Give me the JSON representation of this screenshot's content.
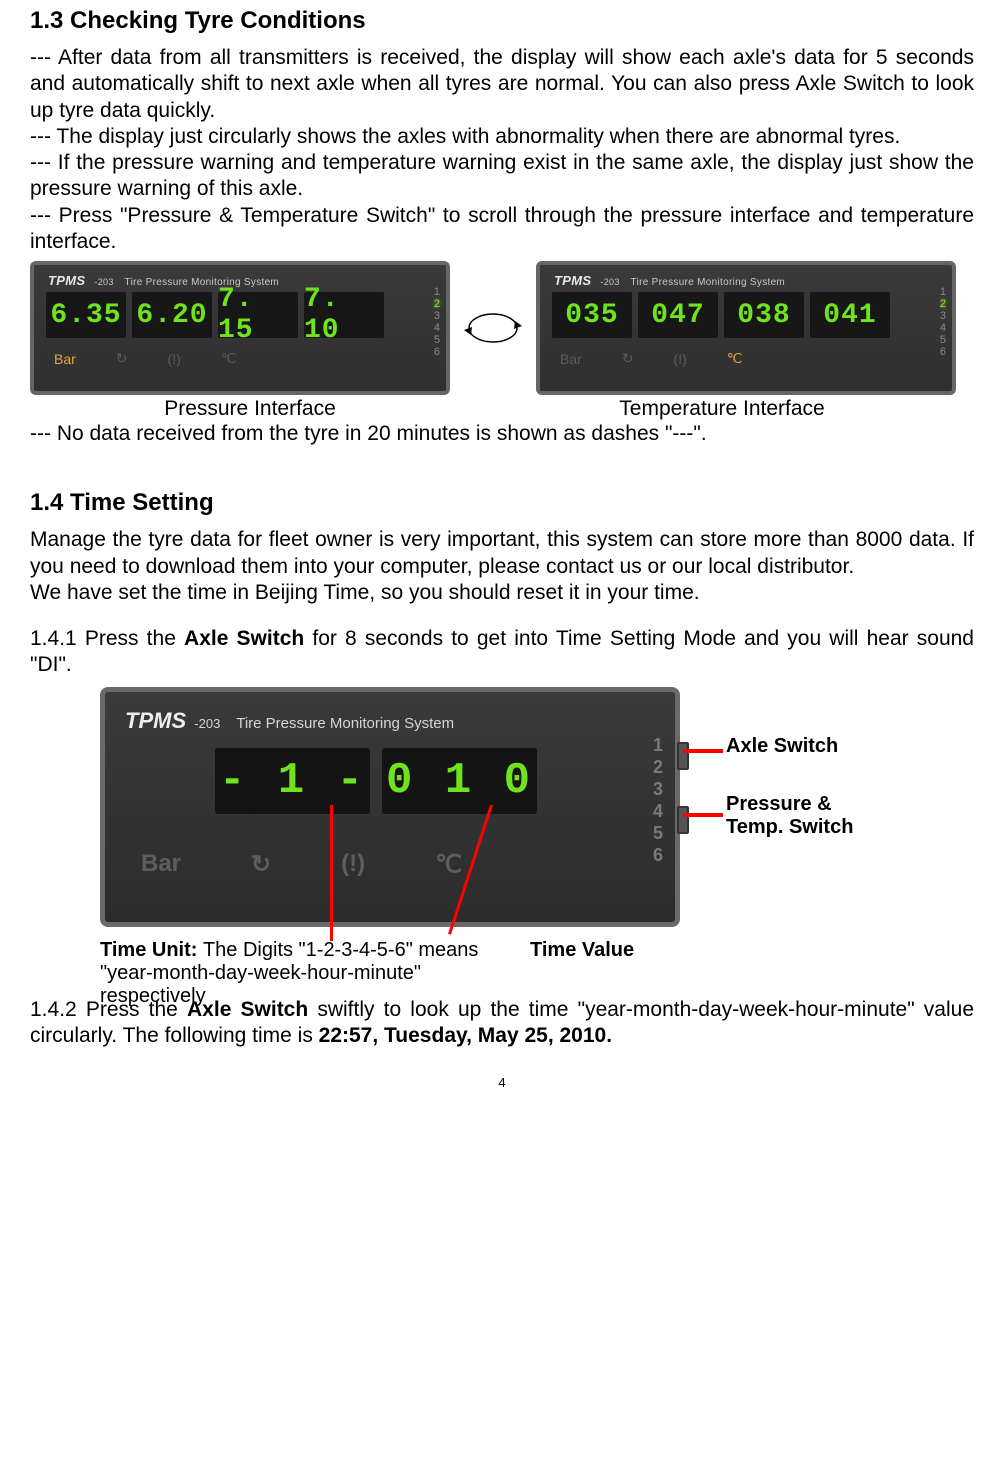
{
  "sections": {
    "s13": {
      "heading": "1.3 Checking Tyre Conditions",
      "p1": "--- After data from all transmitters is received, the display will show each axle's data for 5 seconds and automatically shift to next axle when all tyres are normal. You can also press Axle Switch to look up tyre data quickly.",
      "p2": "--- The display just circularly shows the axles with abnormality when there are abnormal tyres.",
      "p3": "--- If the pressure warning and temperature warning exist in the same axle, the display just show the pressure warning of this axle.",
      "p4": "--- Press \"Pressure & Temperature Switch\" to scroll through the pressure interface and temperature interface.",
      "caption_left": "Pressure Interface",
      "caption_right": "Temperature Interface",
      "p5": "--- No data received from the tyre in 20 minutes is shown as dashes \"---\"."
    },
    "s14": {
      "heading": "1.4 Time Setting",
      "p1": "Manage the tyre data for fleet owner is very important, this system can store more than 8000 data. If you need to download them into your computer, please contact us or our local distributor.",
      "p2": "We have set the time in Beijing Time, so you should reset it in your time.",
      "p3_prefix": "1.4.1 Press the ",
      "p3_bold": "Axle Switch",
      "p3_mid": " for 8 seconds to get into Time Setting Mode and you will hear sound \"DI\".",
      "anno_axle": "Axle Switch",
      "anno_pt1": "Pressure &",
      "anno_pt2": "Temp. Switch",
      "anno_timeunit_b": "Time Unit: ",
      "anno_timeunit_rest": "The Digits \"1-2-3-4-5-6\" means",
      "anno_timeunit_line2": "\"year-month-day-week-hour-minute\" respectively",
      "anno_timevalue": "Time Value",
      "p4_prefix": "1.4.2 Press the ",
      "p4_bold1": "Axle Switch",
      "p4_mid": " swiftly to look up the time \"year-month-day-week-hour-minute\" value circularly. The following time is ",
      "p4_bold2": "22:57, Tuesday, May 25, 2010."
    }
  },
  "panel_common": {
    "brand": "TPMS",
    "model": "-203",
    "tagline": "Tire Pressure Monitoring System",
    "axle_numbers": [
      "1",
      "2",
      "3",
      "4",
      "5",
      "6"
    ],
    "icons": {
      "bar": "Bar",
      "cycle": "↻",
      "warn": "(!)",
      "temp": "℃"
    }
  },
  "pressure_panel": {
    "digits": [
      "6.35",
      "6.20",
      "7. 15",
      "7. 10"
    ],
    "lit_axle_index": 1,
    "lit_icon": "bar"
  },
  "temperature_panel": {
    "digits": [
      "035",
      "047",
      "038",
      "041"
    ],
    "lit_axle_index": 1,
    "lit_icon": "temp"
  },
  "time_panel": {
    "digit_left": "- 1 -",
    "digit_right": "0 1 0"
  },
  "page_number": "4"
}
